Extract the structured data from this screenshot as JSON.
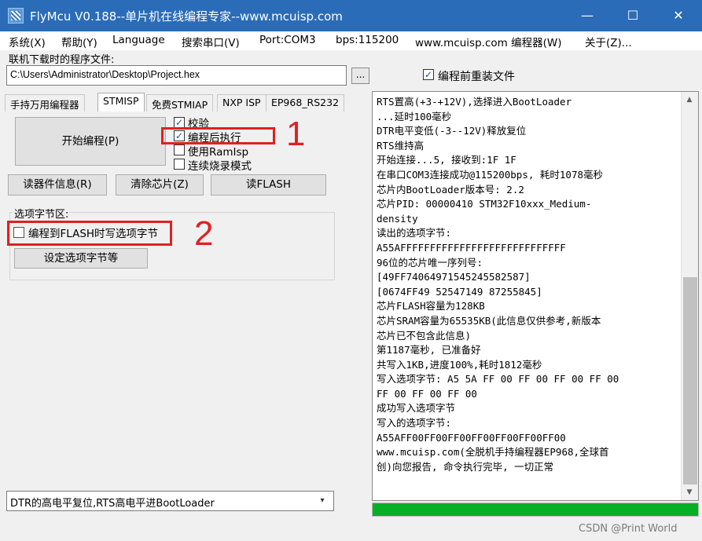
{
  "window": {
    "title": "FlyMcu V0.188--单片机在线编程专家--www.mcuisp.com",
    "minimize": "—",
    "maximize": "☐",
    "close": "✕"
  },
  "menu": {
    "items": [
      "系统(X)",
      "帮助(Y)",
      "Language",
      "搜索串口(V)",
      "Port:COM3",
      "bps:115200",
      "www.mcuisp.com 编程器(W)",
      "关于(Z)..."
    ]
  },
  "file": {
    "label": "联机下载时的程序文件:",
    "path": "C:\\Users\\Administrator\\Desktop\\Project.hex",
    "browse_label": "...",
    "reload_label": "编程前重装文件",
    "reload_checked": "✓"
  },
  "tabs": [
    "手持万用编程器",
    "STMISP",
    "免费STMIAP",
    "NXP ISP",
    "EP968_RS232"
  ],
  "stmisp": {
    "start_button": "开始编程(P)",
    "options": [
      {
        "label": "校验",
        "checked": "✓"
      },
      {
        "label": "编程后执行",
        "checked": "✓"
      },
      {
        "label": "使用RamIsp",
        "checked": ""
      },
      {
        "label": "连续烧录模式",
        "checked": ""
      }
    ],
    "read_info_button": "读器件信息(R)",
    "clear_chip_button": "清除芯片(Z)",
    "read_flash_button": "读FLASH",
    "option_group_label": "选项字节区:",
    "write_option_label": "编程到FLASH时写选项字节",
    "write_option_checked": "",
    "set_option_button": "设定选项字节等"
  },
  "annotations": {
    "one": "1",
    "two": "2"
  },
  "bootloader_select": {
    "value": "DTR的高电平复位,RTS高电平进BootLoader",
    "arrow": "▾"
  },
  "log": {
    "lines": [
      "RTS置高(+3-+12V),选择进入BootLoader",
      "...延时100毫秒",
      "DTR电平变低(-3--12V)释放复位",
      "RTS维持高",
      "开始连接...5, 接收到:1F 1F",
      "在串口COM3连接成功@115200bps, 耗时1078毫秒",
      "芯片内BootLoader版本号: 2.2",
      "芯片PID: 00000410  STM32F10xxx_Medium-",
      "density",
      "读出的选项字节:",
      "A55AFFFFFFFFFFFFFFFFFFFFFFFFFFFF",
      "96位的芯片唯一序列号:",
      "[49FF74064971545245582587]",
      "[0674FF49 52547149 87255845]",
      "芯片FLASH容量为128KB",
      "芯片SRAM容量为65535KB(此信息仅供参考,新版本",
      "芯片已不包含此信息)",
      "第1187毫秒, 已准备好",
      "共写入1KB,进度100%,耗时1812毫秒",
      "写入选项字节:  A5 5A FF 00 FF 00 FF 00 FF 00",
      "FF 00 FF 00 FF 00",
      "成功写入选项字节",
      "写入的选项字节:",
      "A55AFF00FF00FF00FF00FF00FF00FF00",
      "www.mcuisp.com(全脱机手持编程器EP968,全球首",
      "创)向您报告, 命令执行完毕, 一切正常"
    ],
    "scroll_up": "▲",
    "scroll_down": "▼"
  },
  "progress": {
    "fraction": 1.0
  },
  "watermark": "CSDN @Print World",
  "colors": {
    "title_bar": "#2b6cb8",
    "progress_fill": "#06b025",
    "annotation_red": "#e02020"
  }
}
